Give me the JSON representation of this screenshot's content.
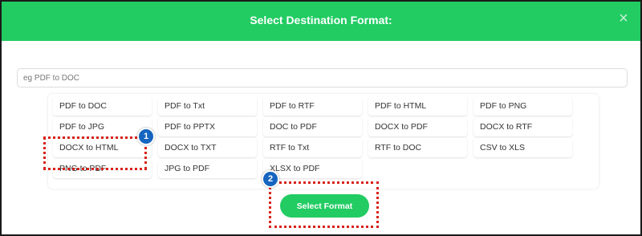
{
  "dialog": {
    "title": "Select Destination Format:",
    "close_label": "×"
  },
  "search": {
    "placeholder": "eg PDF to DOC",
    "value": ""
  },
  "formats": [
    "PDF to DOC",
    "PDF to Txt",
    "PDF to RTF",
    "PDF to HTML",
    "PDF to PNG",
    "PDF to JPG",
    "PDF to PPTX",
    "DOC to PDF",
    "DOCX to PDF",
    "DOCX to RTF",
    "DOCX to HTML",
    "DOCX to TXT",
    "RTF to Txt",
    "RTF to DOC",
    "CSV to XLS",
    "PNG to PDF",
    "JPG to PDF",
    "XLSX to PDF"
  ],
  "select_button": {
    "label": "Select Format"
  },
  "annotations": {
    "marker_1": "1",
    "marker_2": "2"
  },
  "colors": {
    "header": "#22cc63",
    "button": "#22cc63",
    "marker_badge": "#1565c0",
    "highlight_border": "#d8221c"
  }
}
